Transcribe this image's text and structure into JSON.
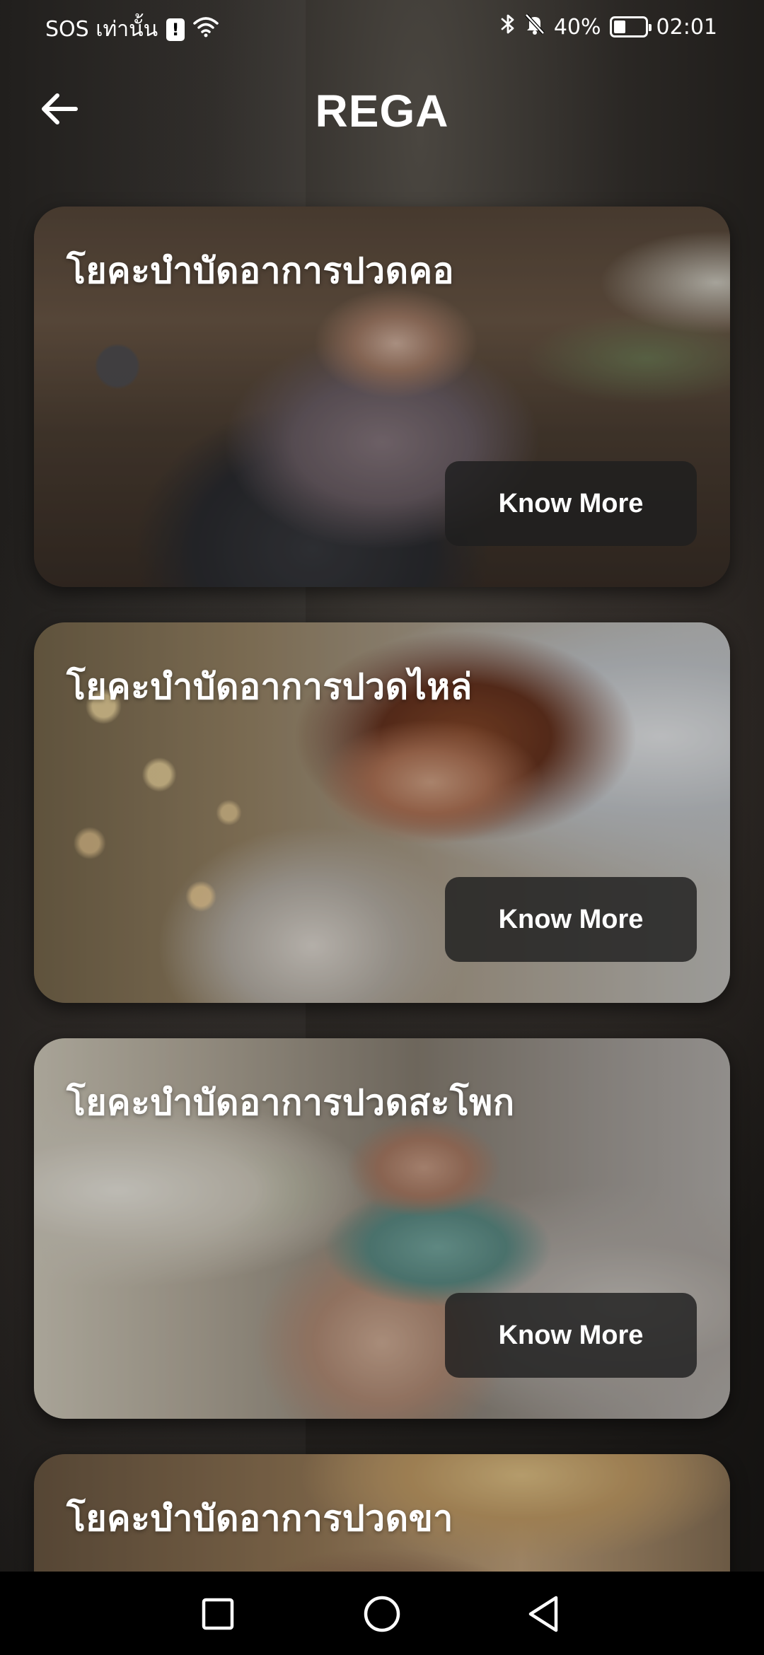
{
  "status_bar": {
    "carrier": "SOS เท่านั้น",
    "battery": "40%",
    "time": "02:01",
    "icons": [
      "sim-alert-icon",
      "wifi-icon",
      "bluetooth-icon",
      "bell-off-icon",
      "battery-icon"
    ]
  },
  "header": {
    "title": "REGA",
    "back_icon": "arrow-left-icon"
  },
  "cards": [
    {
      "title": "โยคะบำบัดอาการปวดคอ",
      "button": "Know More"
    },
    {
      "title": "โยคะบำบัดอาการปวดไหล่",
      "button": "Know More"
    },
    {
      "title": "โยคะบำบัดอาการปวดสะโพก",
      "button": "Know More"
    },
    {
      "title": "โยคะบำบัดอาการปวดขา"
    }
  ],
  "nav_bar": {
    "items": [
      "recents-square-icon",
      "home-circle-icon",
      "back-triangle-icon"
    ]
  },
  "colors": {
    "text": "#ffffff",
    "button_bg": "#1e1e1e",
    "nav_bg": "#000000"
  }
}
